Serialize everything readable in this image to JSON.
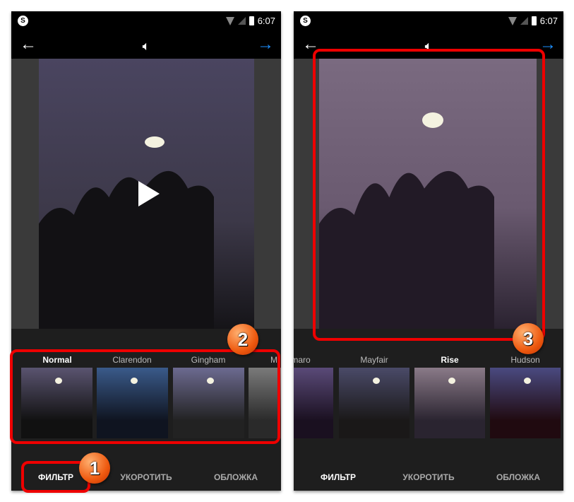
{
  "status": {
    "time": "6:07"
  },
  "left": {
    "filters": [
      {
        "label": "Normal",
        "selected": true,
        "color": "#5a5470"
      },
      {
        "label": "Clarendon",
        "selected": false,
        "color": "#3a5a8a"
      },
      {
        "label": "Gingham",
        "selected": false,
        "color": "#6c6a90"
      },
      {
        "label": "M",
        "selected": false,
        "color": "#7a7a7a"
      }
    ],
    "tabs": [
      {
        "label": "ФИЛЬТР",
        "active": true
      },
      {
        "label": "УКОРОТИТЬ",
        "active": false
      },
      {
        "label": "ОБЛОЖКА",
        "active": false
      }
    ],
    "badges": [
      "1",
      "2"
    ],
    "sky": "#4a4560"
  },
  "right": {
    "filters": [
      {
        "label": "maro",
        "selected": false,
        "color": "#5a4a78"
      },
      {
        "label": "Mayfair",
        "selected": false,
        "color": "#4a4a68"
      },
      {
        "label": "Rise",
        "selected": true,
        "color": "#8a7a88"
      },
      {
        "label": "Hudson",
        "selected": false,
        "color": "#4a4a80"
      }
    ],
    "tabs": [
      {
        "label": "ФИЛЬТР",
        "active": true
      },
      {
        "label": "УКОРОТИТЬ",
        "active": false
      },
      {
        "label": "ОБЛОЖКА",
        "active": false
      }
    ],
    "badges": [
      "3"
    ],
    "sky": "#7a6a80"
  },
  "icons": {
    "back": "arrow-left-icon",
    "sound": "speaker-icon",
    "next": "arrow-right-icon"
  }
}
